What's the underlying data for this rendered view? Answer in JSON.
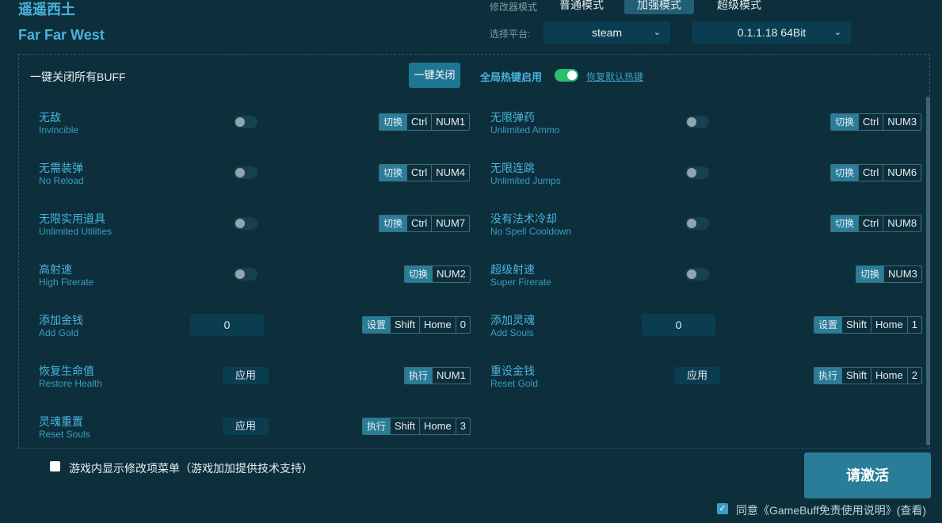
{
  "app": {
    "title_cn": "遥遥西土",
    "title_en": "Far Far West"
  },
  "mode": {
    "label": "修改器模式",
    "options": [
      "普通模式",
      "加强模式",
      "超级模式"
    ],
    "active": "加强模式"
  },
  "platform": {
    "label": "选择平台:",
    "selected": "steam",
    "version": "0.1.1.18 64Bit"
  },
  "toolbar": {
    "close_all_label": "一键关闭所有BUFF",
    "close_all_button": "一键关闭",
    "hotkey_label": "全局热键启用",
    "hotkey_enabled": true,
    "restore_link": "恢复默认热键"
  },
  "cheats": [
    {
      "cn": "无敌",
      "en": "Invincible",
      "control": "toggle",
      "on": false,
      "keys": [
        "切换",
        "Ctrl",
        "NUM1"
      ]
    },
    {
      "cn": "无限弹药",
      "en": "Unlimited Ammo",
      "control": "toggle",
      "on": false,
      "keys": [
        "切换",
        "Ctrl",
        "NUM3"
      ]
    },
    {
      "cn": "无需装弹",
      "en": "No Reload",
      "control": "toggle",
      "on": false,
      "keys": [
        "切换",
        "Ctrl",
        "NUM4"
      ]
    },
    {
      "cn": "无限连跳",
      "en": "Unlimited Jumps",
      "control": "toggle",
      "on": false,
      "keys": [
        "切换",
        "Ctrl",
        "NUM6"
      ]
    },
    {
      "cn": "无限实用道具",
      "en": "Unlimited Utilities",
      "control": "toggle",
      "on": false,
      "keys": [
        "切换",
        "Ctrl",
        "NUM7"
      ]
    },
    {
      "cn": "没有法术冷却",
      "en": "No Spell Cooldown",
      "control": "toggle",
      "on": false,
      "keys": [
        "切换",
        "Ctrl",
        "NUM8"
      ]
    },
    {
      "cn": "高射速",
      "en": "High Firerate",
      "control": "toggle",
      "on": false,
      "keys": [
        "切换",
        "NUM2"
      ]
    },
    {
      "cn": "超级射速",
      "en": "Super Firerate",
      "control": "toggle",
      "on": false,
      "keys": [
        "切换",
        "NUM3"
      ]
    },
    {
      "cn": "添加金钱",
      "en": "Add Gold",
      "control": "value",
      "value": "0",
      "keys": [
        "设置",
        "Shift",
        "Home",
        "0"
      ]
    },
    {
      "cn": "添加灵魂",
      "en": "Add Souls",
      "control": "value",
      "value": "0",
      "keys": [
        "设置",
        "Shift",
        "Home",
        "1"
      ]
    },
    {
      "cn": "恢复生命值",
      "en": "Restore Health",
      "control": "apply",
      "button": "应用",
      "keys": [
        "执行",
        "NUM1"
      ]
    },
    {
      "cn": "重设金钱",
      "en": "Reset Gold",
      "control": "apply",
      "button": "应用",
      "keys": [
        "执行",
        "Shift",
        "Home",
        "2"
      ]
    },
    {
      "cn": "灵魂重置",
      "en": "Reset Souls",
      "control": "apply",
      "button": "应用",
      "keys": [
        "执行",
        "Shift",
        "Home",
        "3"
      ]
    }
  ],
  "footer": {
    "show_menu_label": "游戏内显示修改项菜单（游戏加加提供技术支持）",
    "show_menu_checked": false,
    "activate_button": "请激活",
    "agree_checked": true,
    "agree_text": "同意《GameBuff免责使用说明》(查看)"
  },
  "colors": {
    "background": "#0d2f3c",
    "accent": "#49b3dc",
    "button": "#2a7d99",
    "toggle_on": "#2ac06b"
  },
  "icons": {
    "dropdown": "chevron-down-icon",
    "check": "check-icon"
  }
}
